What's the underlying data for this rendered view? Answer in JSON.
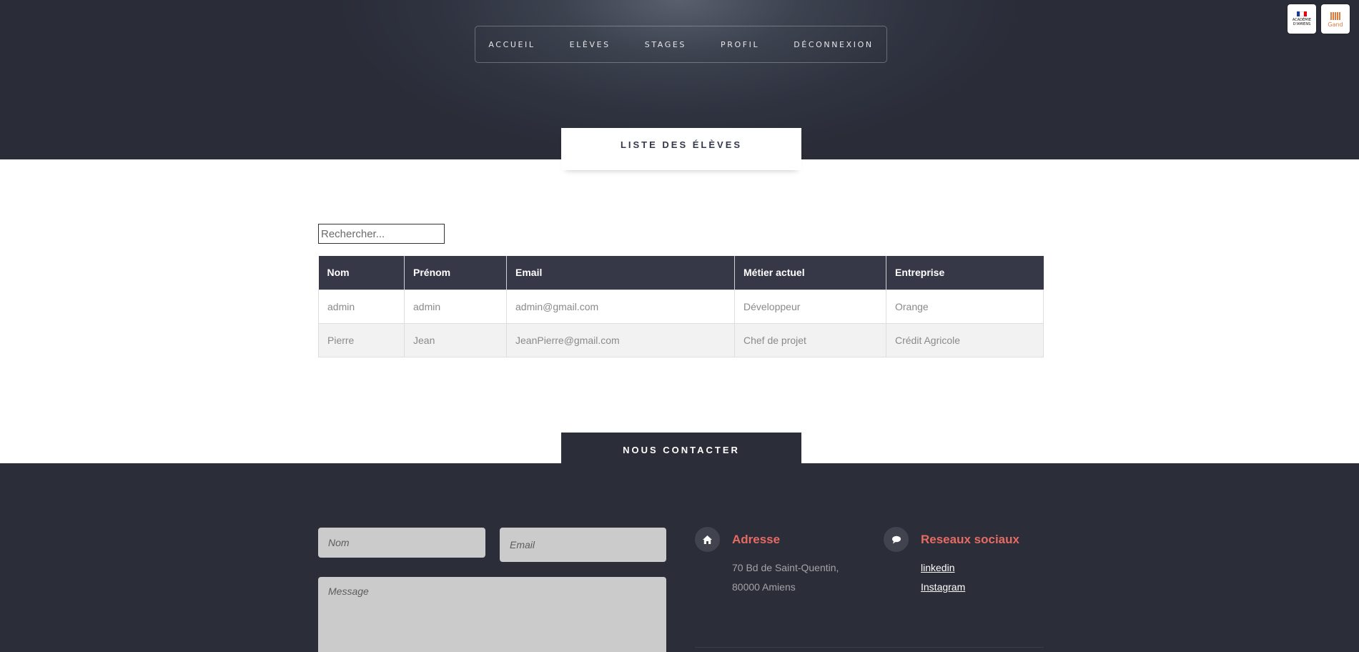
{
  "nav": {
    "items": [
      {
        "label": "ACCUEIL"
      },
      {
        "label": "ELÈVES"
      },
      {
        "label": "STAGES"
      },
      {
        "label": "PROFIL"
      },
      {
        "label": "DÉCONNEXION"
      }
    ]
  },
  "logos": {
    "academie": {
      "text": "ACADÉMIE D'AMIENS"
    },
    "gand": {
      "text": "Gand"
    }
  },
  "page": {
    "title": "LISTE DES ÉLÈVES"
  },
  "search": {
    "placeholder": "Rechercher..."
  },
  "table": {
    "columns": [
      "Nom",
      "Prénom",
      "Email",
      "Métier actuel",
      "Entreprise"
    ],
    "rows": [
      {
        "nom": "admin",
        "prenom": "admin",
        "email": "admin@gmail.com",
        "metier": "Développeur",
        "entreprise": "Orange"
      },
      {
        "nom": "Pierre",
        "prenom": "Jean",
        "email": "JeanPierre@gmail.com",
        "metier": "Chef de projet",
        "entreprise": "Crédit Agricole"
      }
    ]
  },
  "contact": {
    "title": "NOUS CONTACTER",
    "form": {
      "name_placeholder": "Nom",
      "email_placeholder": "Email",
      "message_placeholder": "Message"
    },
    "address": {
      "title": "Adresse",
      "line1": "70 Bd de Saint-Quentin,",
      "line2": "80000 Amiens"
    },
    "social": {
      "title": "Reseaux sociaux",
      "links": [
        "linkedin",
        "Instagram"
      ]
    }
  },
  "colors": {
    "header_dark": "#2f3340",
    "table_header": "#363848",
    "footer_bg": "#2b2d38",
    "accent": "#e76b63"
  },
  "icons": {
    "address": "home-icon",
    "social": "chat-bubble-icon"
  }
}
